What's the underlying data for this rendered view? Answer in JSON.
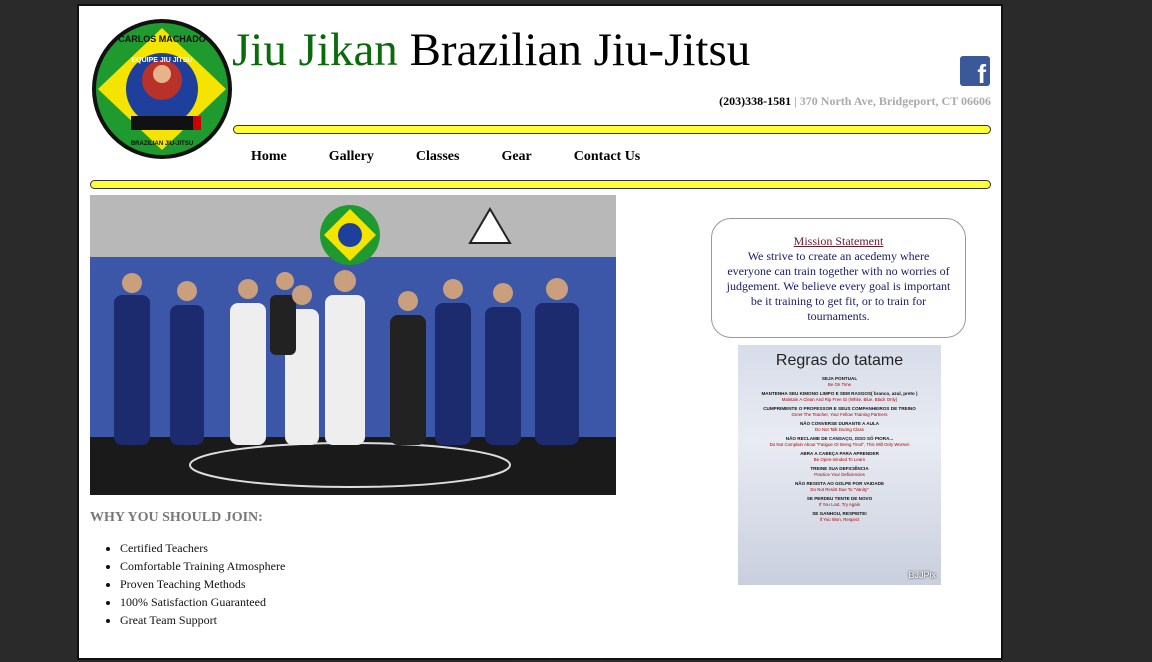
{
  "header": {
    "title_green": "Jiu Jikan",
    "title_black": " Brazilian Jiu-Jitsu",
    "phone": "(203)338-1581",
    "separator": "|",
    "address": "370 North Ave, Bridgeport, CT 06606",
    "facebook_glyph": "f"
  },
  "logo": {
    "ring_top": "CARLOS MACHADO",
    "inner_top": "EQUIPE JIU JITSU",
    "ring_bottom": "BRAZILIAN JIU-JITSU"
  },
  "nav": {
    "items": [
      {
        "label": "Home"
      },
      {
        "label": "Gallery"
      },
      {
        "label": "Classes"
      },
      {
        "label": "Gear"
      },
      {
        "label": "Contact Us"
      }
    ]
  },
  "why": {
    "heading": "WHY YOU SHOULD JOIN:",
    "items": [
      "Certified Teachers",
      "Comfortable Training Atmosphere",
      "Proven Teaching Methods",
      "100% Satisfaction Guaranteed",
      "Great Team Support"
    ]
  },
  "mission": {
    "title": "Mission Statement",
    "text": "We strive to create an acedemy where everyone can train together with no worries of judgement. We believe every goal is important be it training to get fit, or to train for tournaments."
  },
  "rules": {
    "title": "Regras do tatame",
    "watermark": "BJJPix",
    "items": [
      {
        "pt": "SEJA PONTUAL",
        "en": "Be On Time"
      },
      {
        "pt": "MANTENHA SEU KIMONO LIMPO E SEM RASGOS( branco, azul, preto )",
        "en": "Maintain A Clean And Rip Free Gi (White, Blue, Black Only)"
      },
      {
        "pt": "CUMPRIMENTE O PROFESSOR E SEUS COMPANHEIROS DE TREINO",
        "en": "Greet The Teacher, Your Fellow Training Partners"
      },
      {
        "pt": "NÃO CONVERSE DURANTE A AULA",
        "en": "Do Not Talk During Class"
      },
      {
        "pt": "NÃO RECLAME DE CANSAÇO, ISSO SÓ PIORA...",
        "en": "Do Not Complain About \"Fatigue Or Being Tired\", This Will Only Worsen"
      },
      {
        "pt": "ABRA A CABEÇA PARA APRENDER",
        "en": "Be Open-minded To Learn"
      },
      {
        "pt": "TREINE SUA DEFICIÊNCIA",
        "en": "Practice Your Deficiencies"
      },
      {
        "pt": "NÃO RESISTA AO GOLPE POR VAIDADE",
        "en": "Do Not Resist Due To \"Vanity\""
      },
      {
        "pt": "SE PERDEU TENTE DE NOVO",
        "en": "If You Lost, Try Again"
      },
      {
        "pt": "SE GANHOU, RESPEITE!",
        "en": "If You Won, Respect"
      }
    ]
  },
  "colors": {
    "title_green": "#0a6b0a",
    "nav_bar_yellow": "#ffff33",
    "facebook_blue": "#3b5998"
  }
}
